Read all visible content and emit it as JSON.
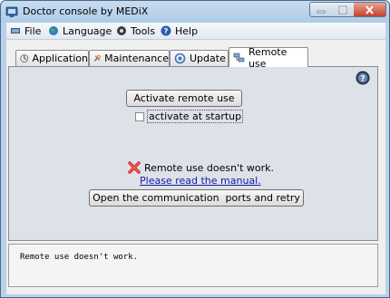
{
  "window": {
    "title": "Doctor console by MEDiX"
  },
  "menu": {
    "items": [
      {
        "label": "File",
        "icon": "file-icon"
      },
      {
        "label": "Language",
        "icon": "globe-icon"
      },
      {
        "label": "Tools",
        "icon": "tools-icon"
      },
      {
        "label": "Help",
        "icon": "help-icon"
      }
    ]
  },
  "tabs": [
    {
      "label": "Application",
      "icon": "application-icon"
    },
    {
      "label": "Maintenance",
      "icon": "wrench-icon"
    },
    {
      "label": "Update",
      "icon": "update-icon"
    },
    {
      "label": "Remote use",
      "icon": "network-icon",
      "active": true
    }
  ],
  "remote_panel": {
    "activate_button": "Activate remote use",
    "startup_checkbox_label": "activate at startup",
    "startup_checked": false,
    "status_message": "Remote use doesn't work.",
    "manual_link": "Please read the manual.",
    "retry_button": "Open the communication  ports and retry"
  },
  "status_box": {
    "text": "Remote use doesn't work."
  },
  "colors": {
    "error": "#d0312d",
    "link": "#1a1aa8",
    "title_bar": "#b9d1ea"
  }
}
